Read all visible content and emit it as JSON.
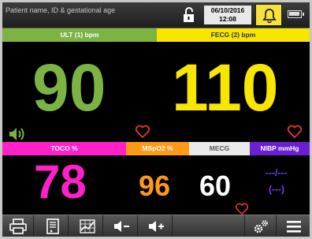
{
  "topbar": {
    "patient_placeholder": "Patient name, ID & gestational age",
    "date": "06/10/2016",
    "time": "12:08"
  },
  "channels": {
    "ult": {
      "label": "ULT (1) bpm",
      "value": "90",
      "color": "#7cb342"
    },
    "fecg": {
      "label": "FECG (2) bpm",
      "value": "110",
      "color": "#f7e600"
    },
    "toco": {
      "label": "TOCO %",
      "value": "78",
      "color": "#ff20c8"
    },
    "spo2": {
      "label": "MSpO2 %",
      "value": "96",
      "color": "#ff9a18"
    },
    "mecg": {
      "label": "MECG",
      "value": "60",
      "color": "#eaeaea"
    },
    "nibp": {
      "label": "NIBP mmHg",
      "value_line1": "---/---",
      "value_line2": "(---)",
      "color": "#6a1fd0"
    }
  },
  "toolbar": {
    "icons": [
      "printer-icon",
      "report-icon",
      "chart-icon",
      "volume-down-icon",
      "volume-up-icon",
      "settings-icon",
      "menu-icon"
    ]
  }
}
